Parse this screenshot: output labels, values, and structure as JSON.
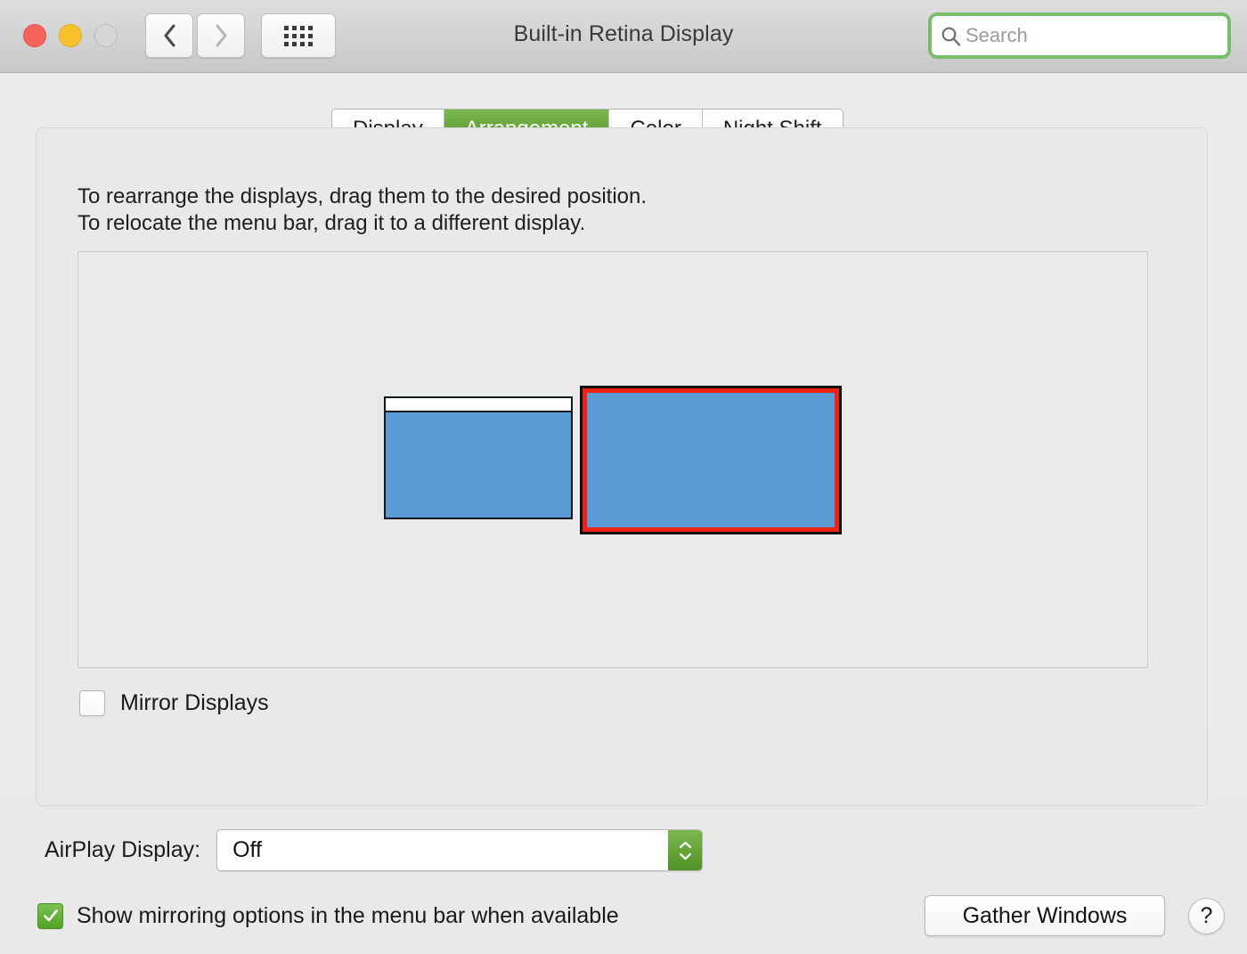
{
  "window": {
    "title": "Built-in Retina Display",
    "traffic_lights": {
      "close_color": "#f6655b",
      "minimize_color": "#f8c22e",
      "zoom_color": "#d6d6d6"
    },
    "nav": {
      "back_label": "back-chevron",
      "forward_label": "forward-chevron",
      "grid_label": "show-all-grid"
    }
  },
  "search": {
    "placeholder": "Search",
    "value": "",
    "icon": "search-icon",
    "highlight_color": "#79bd6a"
  },
  "tabs": [
    {
      "label": "Display",
      "active": false
    },
    {
      "label": "Arrangement",
      "active": true
    },
    {
      "label": "Color",
      "active": false
    },
    {
      "label": "Night Shift",
      "active": false
    }
  ],
  "instructions": {
    "line1": "To rearrange the displays, drag them to the desired position.",
    "line2": "To relocate the menu bar, drag it to a different display."
  },
  "arrangement": {
    "displays": [
      {
        "name": "left-display",
        "has_menu_bar": true,
        "selected": false,
        "fill_color": "#5b9bd5",
        "border_color": "#101820"
      },
      {
        "name": "right-display",
        "has_menu_bar": false,
        "selected": true,
        "fill_color": "#5b9bd5",
        "border_color": "#0d0d0d",
        "selection_color": "#ef2114"
      }
    ]
  },
  "mirror_displays": {
    "label": "Mirror Displays",
    "checked": false
  },
  "airplay": {
    "label": "AirPlay Display:",
    "value": "Off",
    "options": [
      "Off"
    ],
    "accent_color": "#509124"
  },
  "show_mirroring": {
    "label": "Show mirroring options in the menu bar when available",
    "checked": true,
    "accent_color": "#54a327"
  },
  "buttons": {
    "gather_windows": "Gather Windows",
    "help": "?"
  }
}
